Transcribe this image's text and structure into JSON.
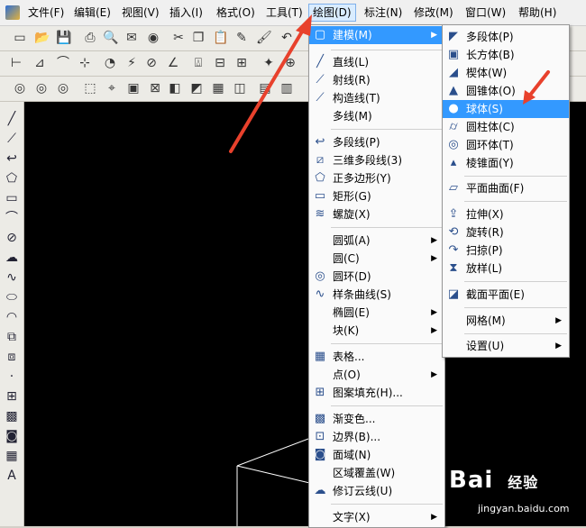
{
  "menubar": {
    "items": [
      "文件(F)",
      "编辑(E)",
      "视图(V)",
      "插入(I)",
      "格式(O)",
      "工具(T)",
      "绘图(D)",
      "标注(N)",
      "修改(M)",
      "窗口(W)",
      "帮助(H)"
    ]
  },
  "draw_menu": {
    "items": [
      {
        "label": "建模(M)",
        "icon": "cube-icon",
        "submenu": true
      },
      {
        "label": "直线(L)",
        "icon": "line-icon"
      },
      {
        "label": "射线(R)",
        "icon": "ray-icon"
      },
      {
        "label": "构造线(T)",
        "icon": "xline-icon"
      },
      {
        "label": "多线(M)",
        "icon": ""
      },
      {
        "label": "多段线(P)",
        "icon": "polyline-icon"
      },
      {
        "label": "三维多段线(3)",
        "icon": "3dpoly-icon"
      },
      {
        "label": "正多边形(Y)",
        "icon": "polygon-icon"
      },
      {
        "label": "矩形(G)",
        "icon": "rectangle-icon"
      },
      {
        "label": "螺旋(X)",
        "icon": "helix-icon"
      },
      {
        "label": "圆弧(A)",
        "icon": "",
        "submenu": true
      },
      {
        "label": "圆(C)",
        "icon": "",
        "submenu": true
      },
      {
        "label": "圆环(D)",
        "icon": "donut-icon"
      },
      {
        "label": "样条曲线(S)",
        "icon": "spline-icon"
      },
      {
        "label": "椭圆(E)",
        "icon": "",
        "submenu": true
      },
      {
        "label": "块(K)",
        "icon": "",
        "submenu": true
      },
      {
        "label": "表格...",
        "icon": "table-icon"
      },
      {
        "label": "点(O)",
        "icon": "",
        "submenu": true
      },
      {
        "label": "图案填充(H)...",
        "icon": "hatch-icon"
      },
      {
        "label": "渐变色...",
        "icon": "gradient-icon"
      },
      {
        "label": "边界(B)...",
        "icon": "boundary-icon"
      },
      {
        "label": "面域(N)",
        "icon": "region-icon"
      },
      {
        "label": "区域覆盖(W)",
        "icon": ""
      },
      {
        "label": "修订云线(U)",
        "icon": "cloud-icon"
      },
      {
        "label": "文字(X)",
        "icon": "",
        "submenu": true
      }
    ]
  },
  "modeling_menu": {
    "items": [
      {
        "label": "多段体(P)",
        "icon": "polysolid-icon"
      },
      {
        "label": "长方体(B)",
        "icon": "box-icon"
      },
      {
        "label": "楔体(W)",
        "icon": "wedge-icon"
      },
      {
        "label": "圆锥体(O)",
        "icon": "cone-icon"
      },
      {
        "label": "球体(S)",
        "icon": "sphere-icon"
      },
      {
        "label": "圆柱体(C)",
        "icon": "cylinder-icon"
      },
      {
        "label": "圆环体(T)",
        "icon": "torus-icon"
      },
      {
        "label": "棱锥面(Y)",
        "icon": "pyramid-icon"
      },
      {
        "label": "平面曲面(F)",
        "icon": "planesurf-icon"
      },
      {
        "label": "拉伸(X)",
        "icon": "extrude-icon"
      },
      {
        "label": "旋转(R)",
        "icon": "revolve-icon"
      },
      {
        "label": "扫掠(P)",
        "icon": "sweep-icon"
      },
      {
        "label": "放样(L)",
        "icon": "loft-icon"
      },
      {
        "label": "截面平面(E)",
        "icon": "section-icon"
      },
      {
        "label": "网格(M)",
        "icon": "",
        "submenu": true
      },
      {
        "label": "设置(U)",
        "icon": "",
        "submenu": true
      }
    ]
  },
  "watermark": {
    "brand": "Bai",
    "brand2": "经验",
    "url": "jingyan.baidu.com"
  },
  "colors": {
    "highlight": "#3399ff",
    "arrow": "#e8412c",
    "canvas": "#000000"
  }
}
